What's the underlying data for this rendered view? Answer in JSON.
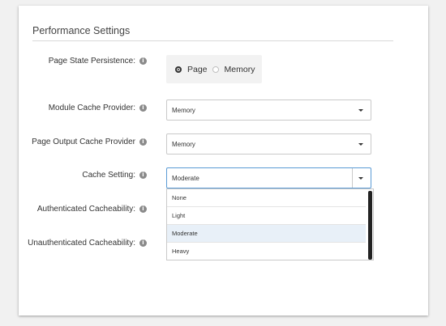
{
  "section": {
    "title": "Performance Settings"
  },
  "page_state": {
    "label": "Page State Persistence:",
    "options": [
      {
        "label": "Page",
        "selected": true
      },
      {
        "label": "Memory",
        "selected": false
      }
    ]
  },
  "module_cache": {
    "label": "Module Cache Provider:",
    "value": "Memory"
  },
  "page_output_cache": {
    "label": "Page Output Cache Provider",
    "value": "Memory"
  },
  "cache_setting": {
    "label": "Cache Setting:",
    "value": "Moderate",
    "options": [
      "None",
      "Light",
      "Moderate",
      "Heavy"
    ],
    "highlighted": "Moderate"
  },
  "auth_cacheability": {
    "label": "Authenticated Cacheability:"
  },
  "unauth_cacheability": {
    "label": "Unauthenticated Cacheability:"
  },
  "icons": {
    "info": "info-icon",
    "caret": "chevron-down-icon"
  },
  "colors": {
    "focus_border": "#5b9bd5",
    "highlight": "#e8f0f8"
  }
}
